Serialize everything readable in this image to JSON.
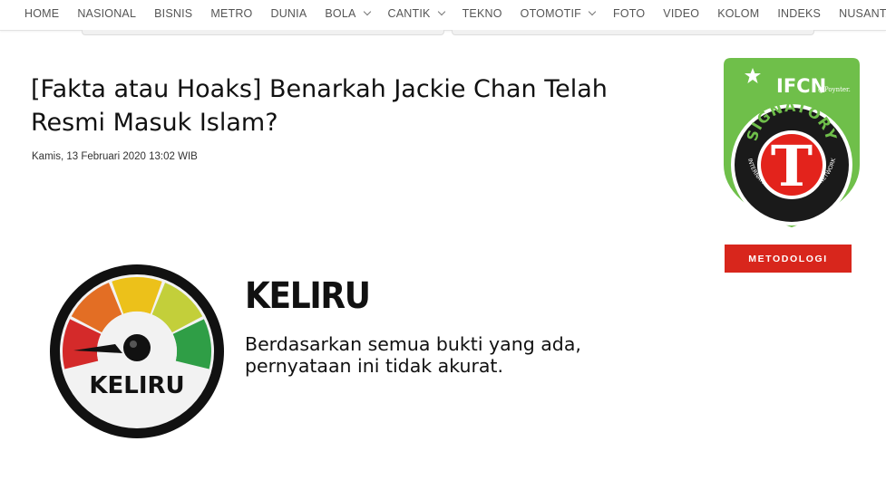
{
  "nav": {
    "items": [
      {
        "label": "HOME",
        "dropdown": false
      },
      {
        "label": "NASIONAL",
        "dropdown": false
      },
      {
        "label": "BISNIS",
        "dropdown": false
      },
      {
        "label": "METRO",
        "dropdown": false
      },
      {
        "label": "DUNIA",
        "dropdown": false
      },
      {
        "label": "BOLA",
        "dropdown": true
      },
      {
        "label": "CANTIK",
        "dropdown": true
      },
      {
        "label": "TEKNO",
        "dropdown": false
      },
      {
        "label": "OTOMOTIF",
        "dropdown": true
      },
      {
        "label": "FOTO",
        "dropdown": false
      },
      {
        "label": "VIDEO",
        "dropdown": false
      },
      {
        "label": "KOLOM",
        "dropdown": false
      },
      {
        "label": "INDEKS",
        "dropdown": false
      },
      {
        "label": "NUSANTARA",
        "dropdown": true
      }
    ]
  },
  "article": {
    "title": "[Fakta atau Hoaks] Benarkah Jackie Chan Telah Resmi Masuk Islam?",
    "date": "Kamis, 13 Februari 2020 13:02 WIB"
  },
  "sidebar": {
    "badge": {
      "brand": "IFCN",
      "brand_suffix": "@Poynter.",
      "arc_text": "SIGNATORY",
      "ring_text": "INTERNATIONAL FACT-CHECKING NETWORK",
      "letter": "T"
    },
    "metodologi_label": "METODOLOGI"
  },
  "verdict": {
    "gauge_label": "KELIRU",
    "heading": "KELIRU",
    "description": "Berdasarkan semua bukti yang ada, pernyataan ini tidak akurat."
  },
  "colors": {
    "accent_red": "#d8261c",
    "badge_green": "#6fbf4a",
    "gauge_red": "#d42a2a",
    "gauge_orange": "#e36e24",
    "gauge_yellow": "#ecc11a",
    "gauge_lime": "#c3cf3a",
    "gauge_green": "#2f9e46"
  }
}
